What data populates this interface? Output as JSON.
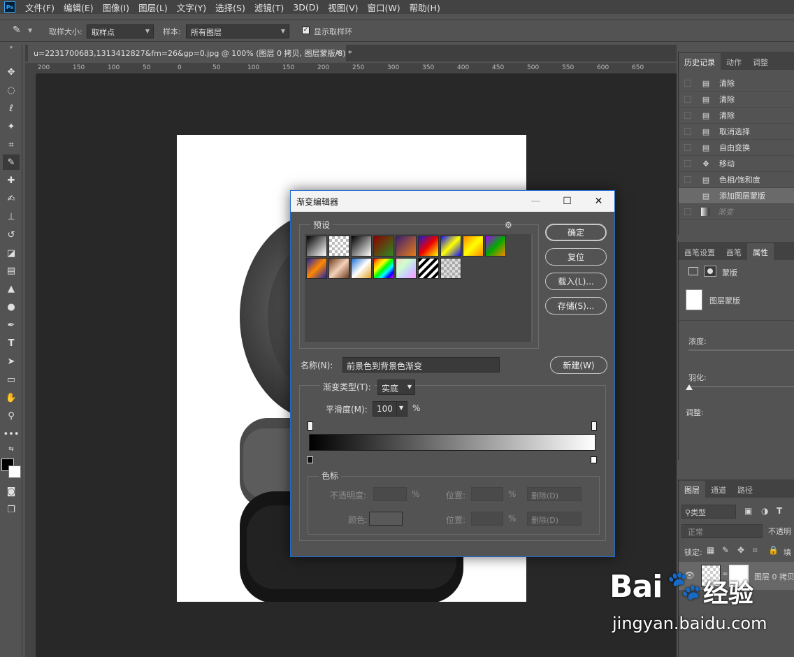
{
  "app": {
    "logo": "Ps",
    "menu": [
      "文件(F)",
      "编辑(E)",
      "图像(I)",
      "图层(L)",
      "文字(Y)",
      "选择(S)",
      "滤镜(T)",
      "3D(D)",
      "视图(V)",
      "窗口(W)",
      "帮助(H)"
    ]
  },
  "options": {
    "sample_size_label": "取样大小:",
    "sample_size_value": "取样点",
    "sample_label": "样本:",
    "sample_value": "所有图层",
    "show_ring_label": "显示取样环",
    "show_ring_checked": true
  },
  "document": {
    "tab_title": "u=2231700683,1313412827&fm=26&gp=0.jpg @ 100% (图层 0 拷贝, 图层蒙版/8) *",
    "close_glyph": "×",
    "ruler_ticks": [
      "200",
      "150",
      "100",
      "50",
      "0",
      "50",
      "100",
      "150",
      "200",
      "250",
      "300",
      "350",
      "400",
      "450",
      "500",
      "550",
      "600",
      "650"
    ]
  },
  "history": {
    "tabs": [
      "历史记录",
      "动作",
      "调整"
    ],
    "items": [
      {
        "label": "清除",
        "icon": "doc-icon"
      },
      {
        "label": "清除",
        "icon": "doc-icon"
      },
      {
        "label": "清除",
        "icon": "doc-icon"
      },
      {
        "label": "取消选择",
        "icon": "doc-icon"
      },
      {
        "label": "自由变换",
        "icon": "doc-icon"
      },
      {
        "label": "移动",
        "icon": "move-icon"
      },
      {
        "label": "色相/饱和度",
        "icon": "doc-icon"
      },
      {
        "label": "添加图层蒙版",
        "icon": "doc-icon"
      },
      {
        "label": "渐变",
        "icon": "gradient-icon"
      }
    ]
  },
  "properties": {
    "tabs": [
      "画笔设置",
      "画笔",
      "属性"
    ],
    "mask_label": "蒙版",
    "layer_mask_label": "图层蒙版",
    "density_label": "浓度:",
    "feather_label": "羽化:",
    "adjust_label": "调整:"
  },
  "layers": {
    "tabs": [
      "图层",
      "通道",
      "路径"
    ],
    "filter_label": "类型",
    "blend_mode": "正常",
    "opacity_label": "不透明",
    "lock_label": "锁定:",
    "fill_label": "填",
    "layer_name": "图层 0 拷贝"
  },
  "dialog": {
    "title": "渐变编辑器",
    "presets_label": "预设",
    "ok": "确定",
    "reset": "复位",
    "load": "载入(L)...",
    "save": "存储(S)...",
    "name_label": "名称(N):",
    "name_value": "前景色到背景色渐变",
    "new": "新建(W)",
    "type_label": "渐变类型(T):",
    "type_value": "实底",
    "smooth_label": "平滑度(M):",
    "smooth_value": "100",
    "percent": "%",
    "stops_label": "色标",
    "opacity_label": "不透明度:",
    "color_label": "颜色:",
    "position_label": "位置:",
    "delete": "删除(D)"
  },
  "watermark": {
    "brand": "Bai",
    "brand_cn": "经验",
    "url": "jingyan.baidu.com"
  }
}
